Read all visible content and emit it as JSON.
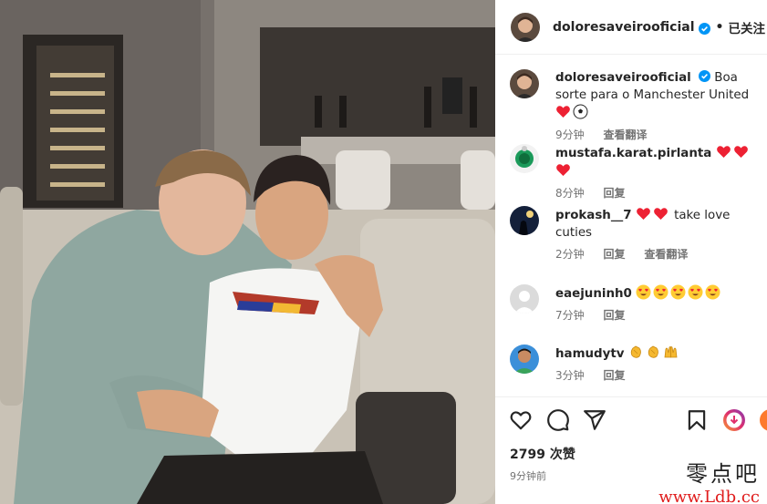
{
  "post": {
    "author": "doloresaveirooficial",
    "follow_status": "已关注",
    "separator": "•"
  },
  "comments": [
    {
      "username": "doloresaveirooficial",
      "text": "Boa sorte para o Manchester United",
      "emoji": [
        "heart",
        "soccer"
      ],
      "time": "9分钟",
      "action": "查看翻译",
      "verified": true
    },
    {
      "username": "mustafa.karat.pirlanta",
      "text": "",
      "emoji": [
        "heart",
        "heart",
        "heart"
      ],
      "time": "8分钟",
      "action": "回复"
    },
    {
      "username": "prokash__7",
      "text": "take love cuties",
      "emoji": [
        "heart",
        "heart"
      ],
      "time": "2分钟",
      "action": "回复",
      "action2": "查看翻译"
    },
    {
      "username": "eaejuninh0",
      "text": "",
      "emoji": [
        "heart-eyes",
        "heart-eyes",
        "heart-eyes",
        "heart-eyes",
        "heart-eyes"
      ],
      "time": "7分钟",
      "action": "回复"
    },
    {
      "username": "hamudytv",
      "text": "",
      "emoji": [
        "clap",
        "clap",
        "raised-hands"
      ],
      "time": "3分钟",
      "action": "回复"
    }
  ],
  "actions": [
    "heart-icon",
    "comment-icon",
    "share-icon",
    "save-icon"
  ],
  "stats": {
    "likes": "2799 次赞",
    "posted": "9分钟前"
  },
  "watermark": {
    "line1": "零点吧",
    "line2": "www.Ldb.cc"
  },
  "colors": {
    "verified": "#0095f6",
    "heart": "#ed2133",
    "watermark_red": "#e01c1c"
  }
}
